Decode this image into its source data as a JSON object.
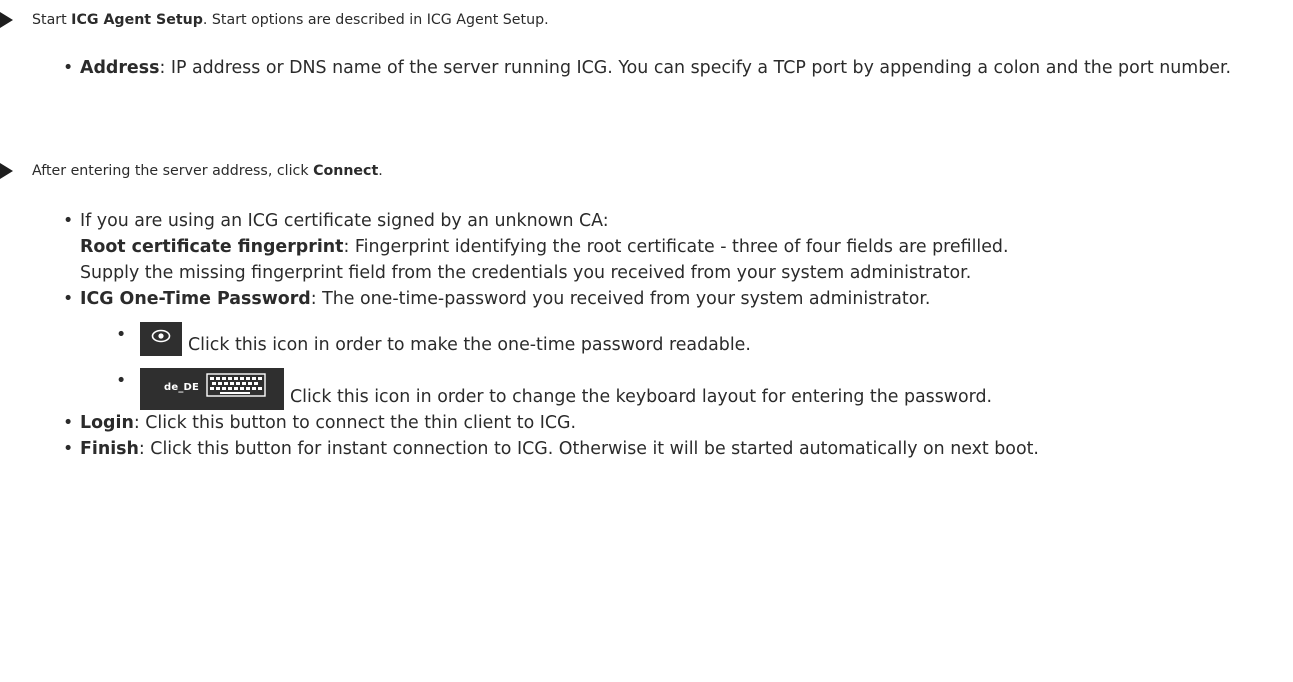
{
  "step1": {
    "prefix": "Start ",
    "bold": "ICG Agent Setup",
    "suffix": ". Start options are described in ICG Agent Setup."
  },
  "address_item": {
    "label": "Address",
    "text": ": IP address or DNS name of the server running ICG. You can specify a TCP port by appending a colon and the port number."
  },
  "step2": {
    "prefix": "After entering the server address, click ",
    "bold": "Connect",
    "suffix": "."
  },
  "cert_item": {
    "intro": "If you are using an ICG certificate signed by an unknown CA:",
    "label": "Root certificate fingerprint",
    "text": ": Fingerprint identifying the root certificate - three of four fields are prefilled.",
    "supply": "Supply the missing fingerprint field from the credentials you received from your system administrator."
  },
  "otp_item": {
    "label": "ICG One-Time Password",
    "text": ": The one-time-password you received from your system administrator.",
    "eye_text": "Click this icon in order to make the one-time password readable.",
    "kbd_lang": "de_DE",
    "kbd_text": "Click this icon in order to change the keyboard layout for entering the password."
  },
  "login_item": {
    "label": "Login",
    "text": ": Click this button to connect the thin client to ICG."
  },
  "finish_item": {
    "label": "Finish",
    "text": ": Click this button for instant connection to ICG. Otherwise it will be started automatically on next boot."
  },
  "icons": {
    "step_marker": "triangle-right-icon",
    "eye": "eye-icon",
    "keyboard": "keyboard-icon"
  }
}
